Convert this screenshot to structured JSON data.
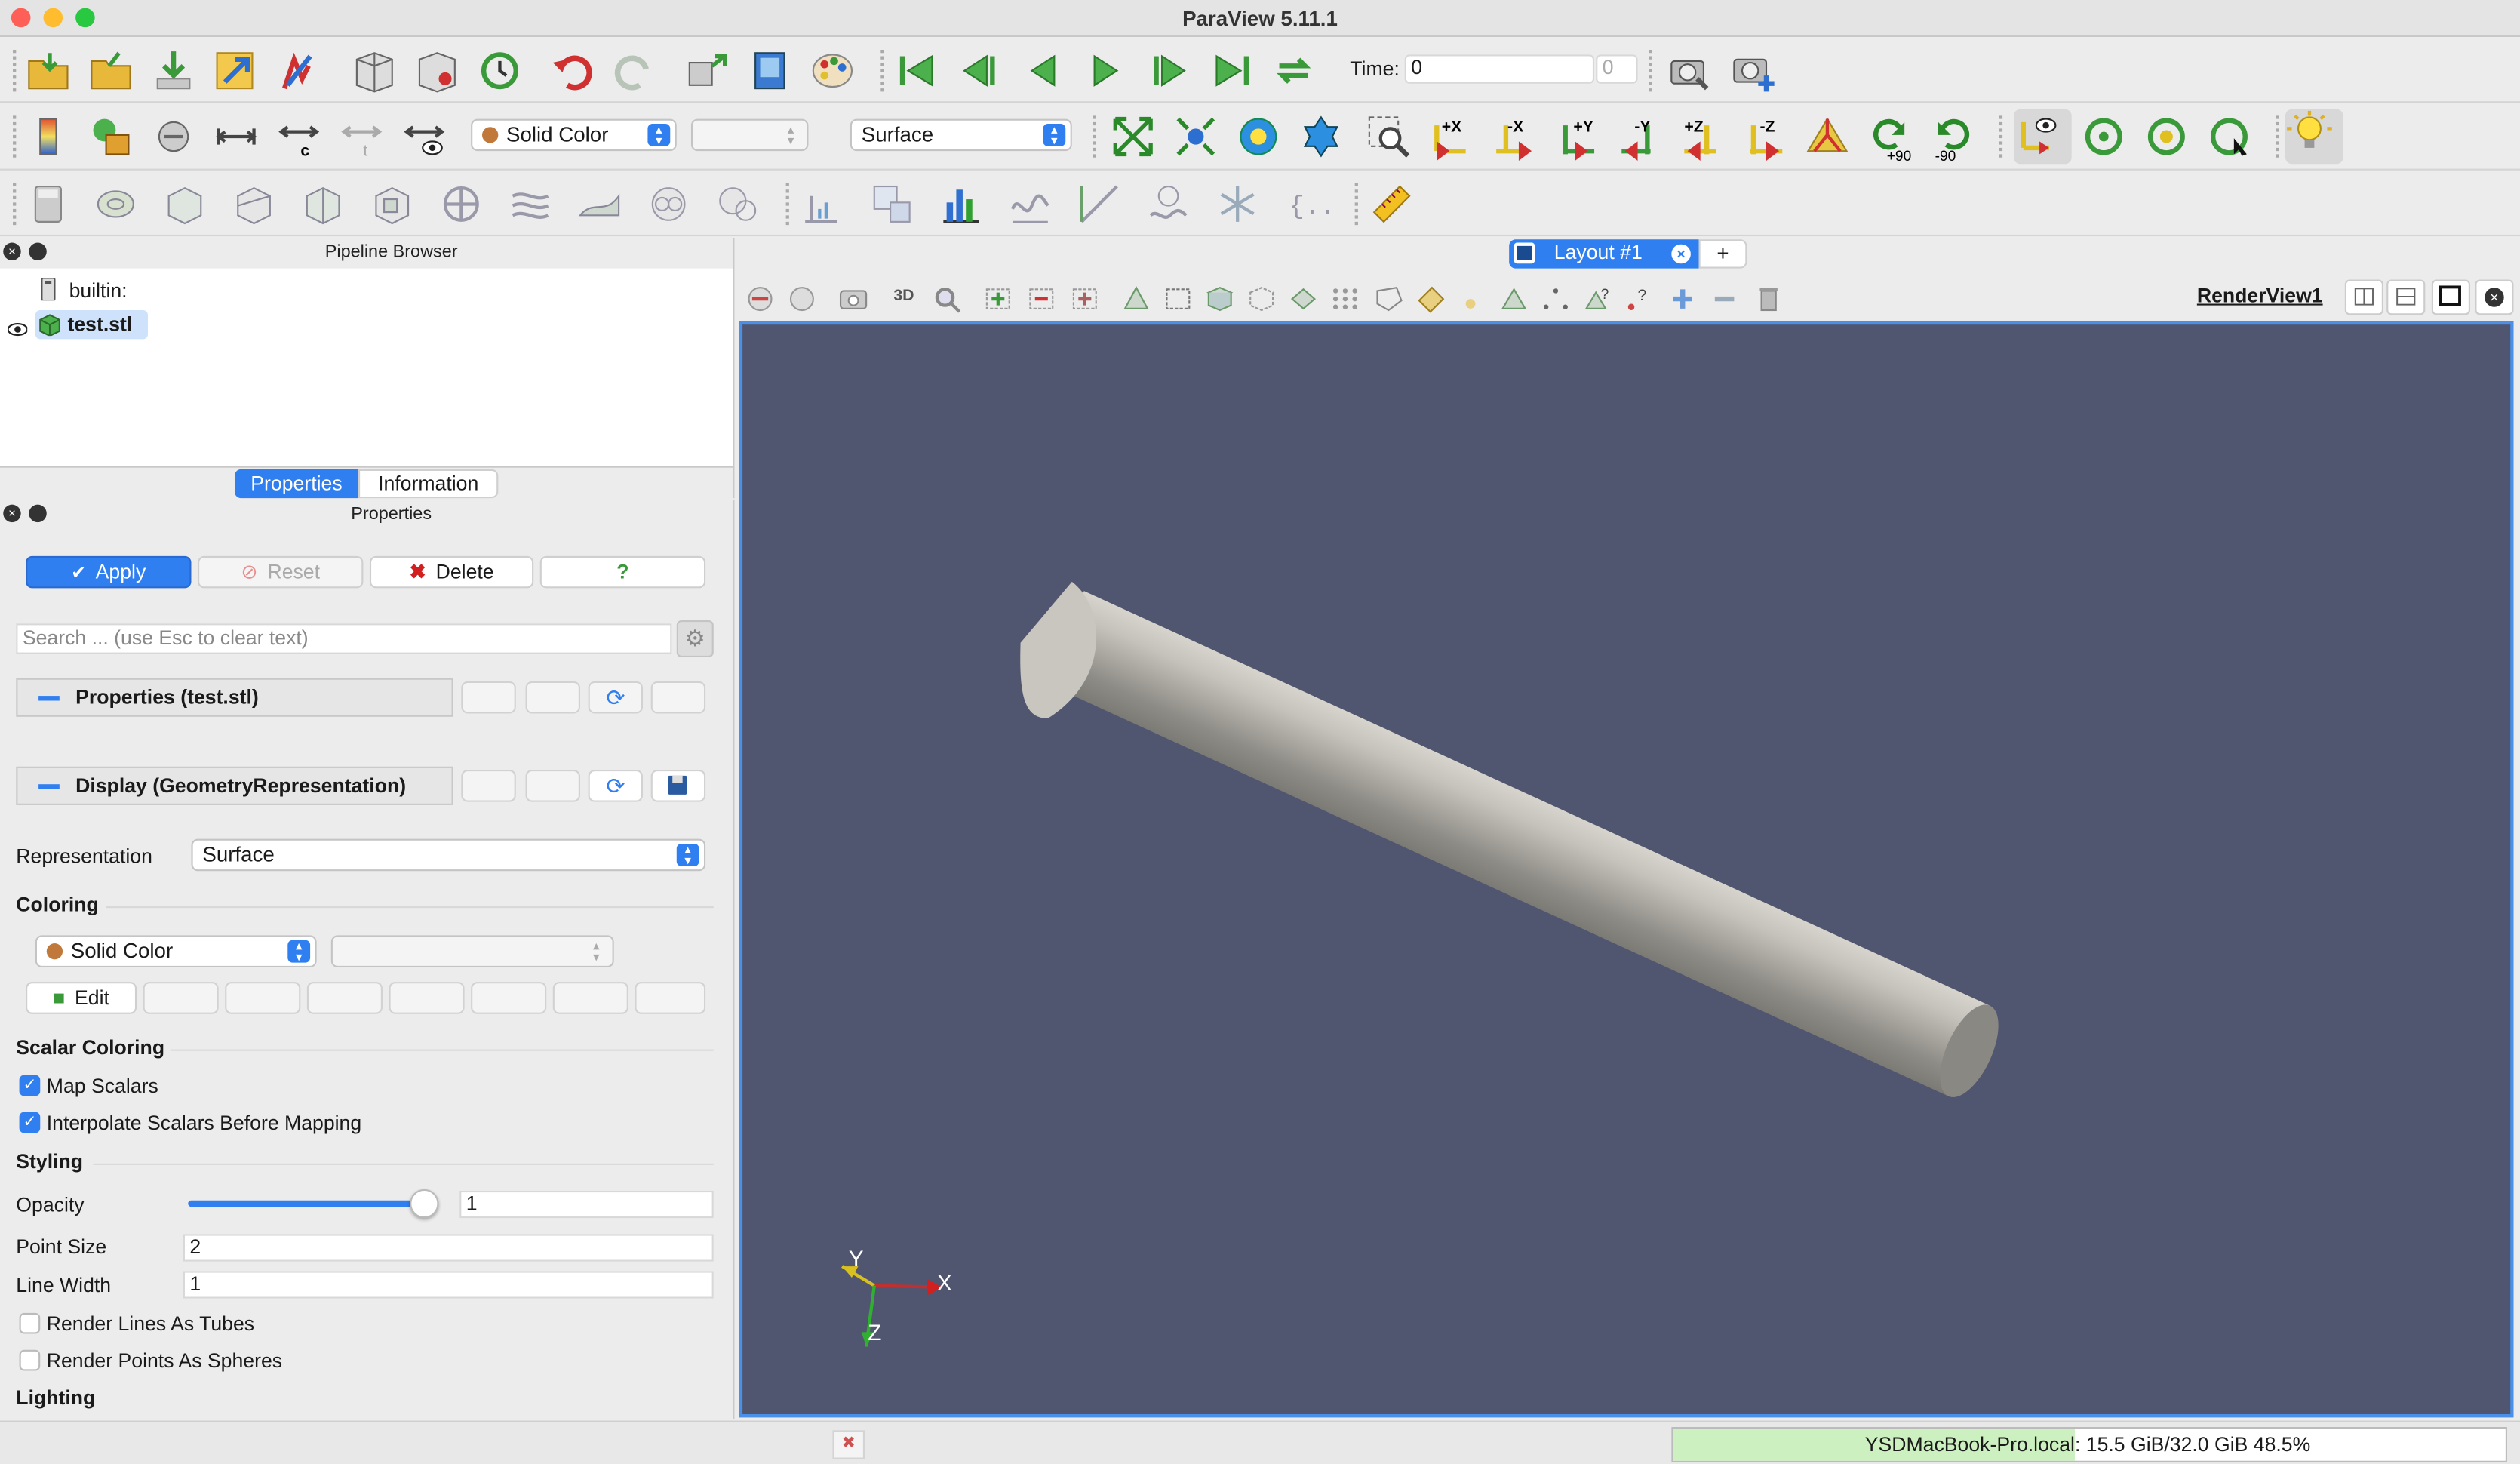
{
  "window": {
    "title": "ParaView 5.11.1"
  },
  "toolbar": {
    "time_label": "Time:",
    "time_value": "0",
    "time_index": "0",
    "coloring_combo": "Solid Color",
    "representation_combo": "Surface",
    "rotate_plus90": "+90",
    "rotate_minus90": "-90",
    "view_buttons": [
      "+X",
      "-X",
      "+Y",
      "-Y",
      "+Z",
      "-Z"
    ]
  },
  "pipeline": {
    "header": "Pipeline Browser",
    "items": [
      {
        "label": "builtin:"
      },
      {
        "label": "test.stl"
      }
    ]
  },
  "tabs": {
    "properties": "Properties",
    "information": "Information"
  },
  "properties": {
    "header": "Properties",
    "apply": "Apply",
    "reset": "Reset",
    "delete": "Delete",
    "help": "?",
    "search_placeholder": "Search ... (use Esc to clear text)",
    "section_properties": "Properties (test.stl)",
    "section_display": "Display (GeometryRepresentation)",
    "representation_label": "Representation",
    "representation_value": "Surface",
    "coloring_label": "Coloring",
    "coloring_value": "Solid Color",
    "edit": "Edit",
    "scalar_coloring_label": "Scalar Coloring",
    "map_scalars": "Map Scalars",
    "interpolate_scalars": "Interpolate Scalars Before Mapping",
    "styling_label": "Styling",
    "opacity_label": "Opacity",
    "opacity_value": "1",
    "opacity_level": 1.0,
    "point_size_label": "Point Size",
    "point_size_value": "2",
    "line_width_label": "Line Width",
    "line_width_value": "1",
    "render_lines_tubes": "Render Lines As Tubes",
    "render_points_spheres": "Render Points As Spheres",
    "lighting_label": "Lighting"
  },
  "layout": {
    "tab": "Layout #1",
    "add": "+",
    "view_name": "RenderView1",
    "view_3d": "3D"
  },
  "axes": {
    "y": "Y",
    "x": "X",
    "z": "Z"
  },
  "status": {
    "host": "YSDMacBook-Pro.local",
    "memory": ": 15.5 GiB/32.0 GiB 48.5%"
  },
  "colors": {
    "accent": "#2f7ff0",
    "render_bg": "#515670",
    "mesh": "#c8c6bf"
  }
}
